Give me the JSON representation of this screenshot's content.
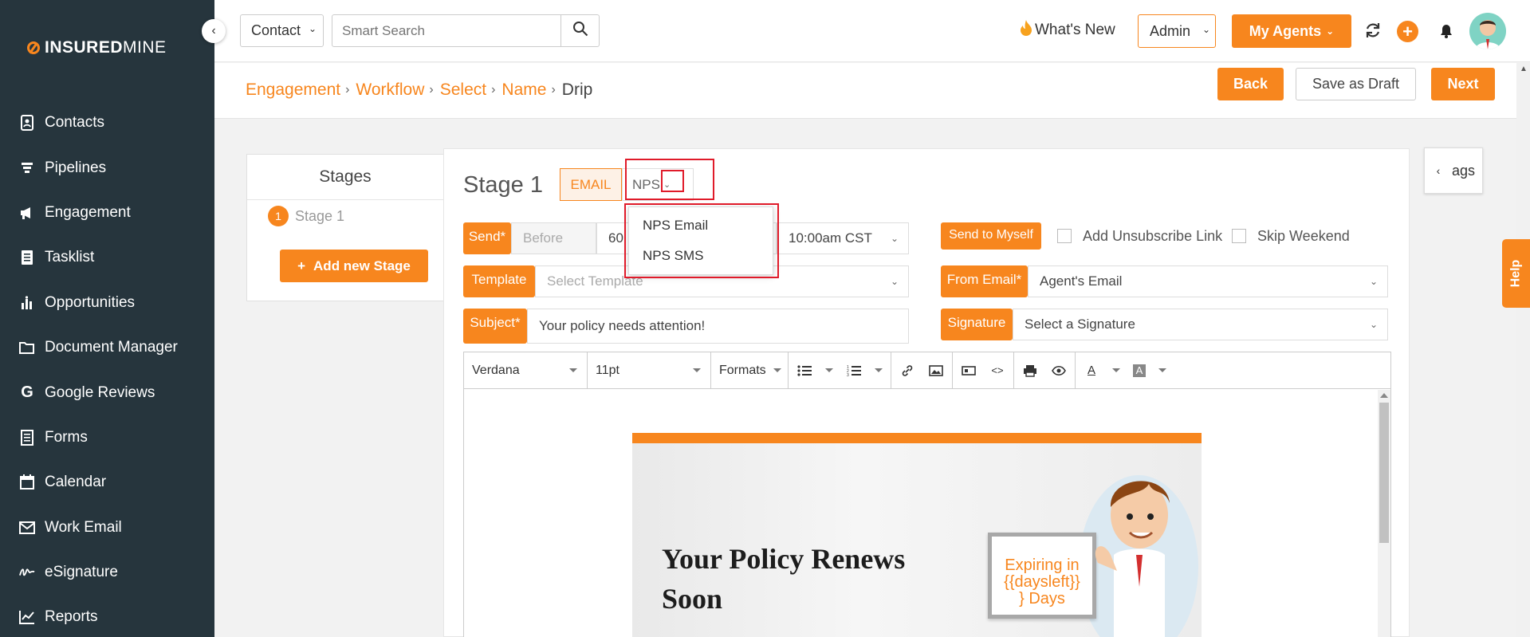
{
  "sidebar": {
    "logo_bold": "INSURED",
    "logo_light": "MINE",
    "items": [
      {
        "label": "Contacts",
        "icon": "contact-book-icon"
      },
      {
        "label": "Pipelines",
        "icon": "funnel-icon"
      },
      {
        "label": "Engagement",
        "icon": "megaphone-icon"
      },
      {
        "label": "Tasklist",
        "icon": "list-icon"
      },
      {
        "label": "Opportunities",
        "icon": "bar-chart-icon"
      },
      {
        "label": "Document Manager",
        "icon": "folder-icon"
      },
      {
        "label": "Google Reviews",
        "icon": "google-icon"
      },
      {
        "label": "Forms",
        "icon": "form-icon"
      },
      {
        "label": "Calendar",
        "icon": "calendar-icon"
      },
      {
        "label": "Work Email",
        "icon": "envelope-icon"
      },
      {
        "label": "eSignature",
        "icon": "signature-icon"
      },
      {
        "label": "Reports",
        "icon": "line-chart-icon"
      }
    ]
  },
  "topbar": {
    "contact_select": "Contact",
    "search_placeholder": "Smart Search",
    "whats_new": "What's New",
    "admin": "Admin",
    "my_agents": "My Agents"
  },
  "breadcrumb": {
    "items": [
      "Engagement",
      "Workflow",
      "Select",
      "Name"
    ],
    "current": "Drip"
  },
  "actions": {
    "back": "Back",
    "save_draft": "Save as Draft",
    "next": "Next"
  },
  "stages": {
    "title": "Stages",
    "items": [
      {
        "num": "1",
        "label": "Stage 1"
      }
    ],
    "add_label": "Add new Stage"
  },
  "stage_form": {
    "heading": "Stage 1",
    "tab_email": "EMAIL",
    "tab_nps": "NPS",
    "nps_options": [
      "NPS Email",
      "NPS SMS"
    ],
    "send_label": "Send*",
    "send_when": "Before",
    "send_days": "60",
    "send_time": "10:00am CST",
    "send_to_myself": "Send to Myself",
    "add_unsubscribe": "Add Unsubscribe Link",
    "skip_weekend": "Skip Weekend",
    "template_label": "Template",
    "template_placeholder": "Select Template",
    "from_email_label": "From Email*",
    "from_email_value": "Agent's Email",
    "subject_label": "Subject*",
    "subject_value": "Your policy needs attention!",
    "signature_label": "Signature",
    "signature_value": "Select a Signature"
  },
  "editor": {
    "font": "Verdana",
    "size": "11pt",
    "formats": "Formats"
  },
  "email_preview": {
    "title": "Your Policy Renews Soon",
    "sign_line1": "Expiring in",
    "sign_line2": "{{daysleft}}",
    "sign_line3": "} Days"
  },
  "tags_tab": "ags",
  "help_tab": "Help",
  "colors": {
    "sidebar_bg": "#26353d",
    "accent": "#f7861e",
    "highlight": "#e01b2a"
  }
}
